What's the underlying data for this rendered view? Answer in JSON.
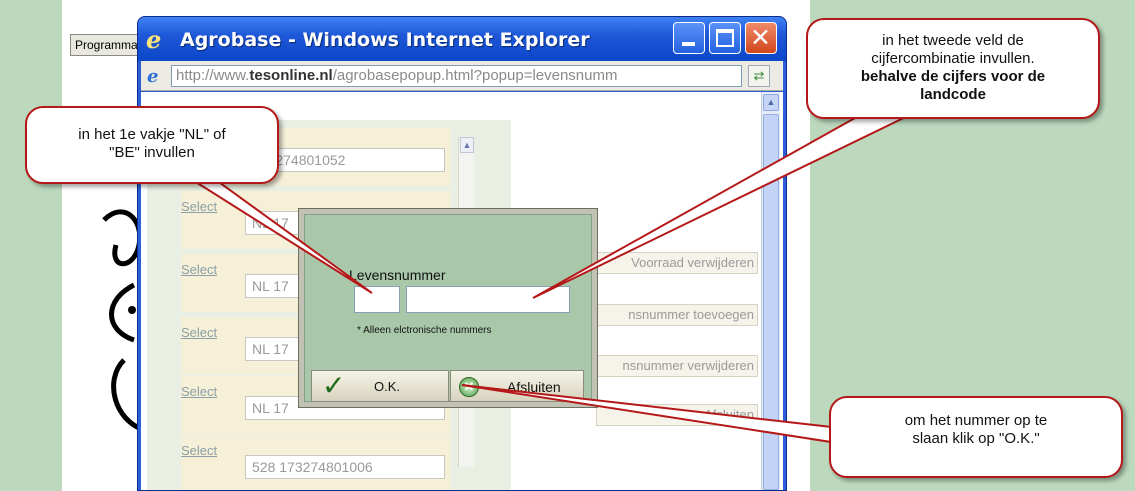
{
  "background": {
    "program_button_label": "Programma"
  },
  "window": {
    "title": "Agrobase - Windows Internet Explorer",
    "address_url_host": "http://www.",
    "address_url_domain": "tesonline.nl",
    "address_url_path": "/agrobasepopup.html?popup=levensnumm"
  },
  "list": {
    "rows": [
      {
        "select": "",
        "number": "173274801052"
      },
      {
        "select": "Select",
        "number": "NL 17"
      },
      {
        "select": "Select",
        "number": "NL 17"
      },
      {
        "select": "Select",
        "number": "NL 17"
      },
      {
        "select": "Select",
        "number": "NL 17"
      },
      {
        "select": "Select",
        "number": "528 173274801006"
      }
    ]
  },
  "right_buttons": [
    "Voorraad verwijderen",
    "nsnummer toevoegen",
    "nsnummer verwijderen",
    "Afsluiten"
  ],
  "dialog": {
    "label": "Levensnummer",
    "country_value": "",
    "number_value": "",
    "note": "* Alleen elctronische nummers",
    "ok_label": "O.K.",
    "close_label": "Afsluiten"
  },
  "callouts": {
    "one_line1": "in het 1e vakje \"NL\" of",
    "one_line2": "\"BE\" invullen",
    "two_line1": "in het tweede veld de",
    "two_line2": "cijfercombinatie invullen.",
    "two_line3": "behalve de cijfers voor de",
    "two_line4": "landcode",
    "three_line1": "om het nummer op te",
    "three_line2": "slaan klik op \"O.K.\""
  },
  "colors": {
    "callout_border": "#b41818",
    "titlebar": "#1f59d9",
    "dialog_bg": "#a9c8aa",
    "page_bg": "#bcd9bd"
  }
}
